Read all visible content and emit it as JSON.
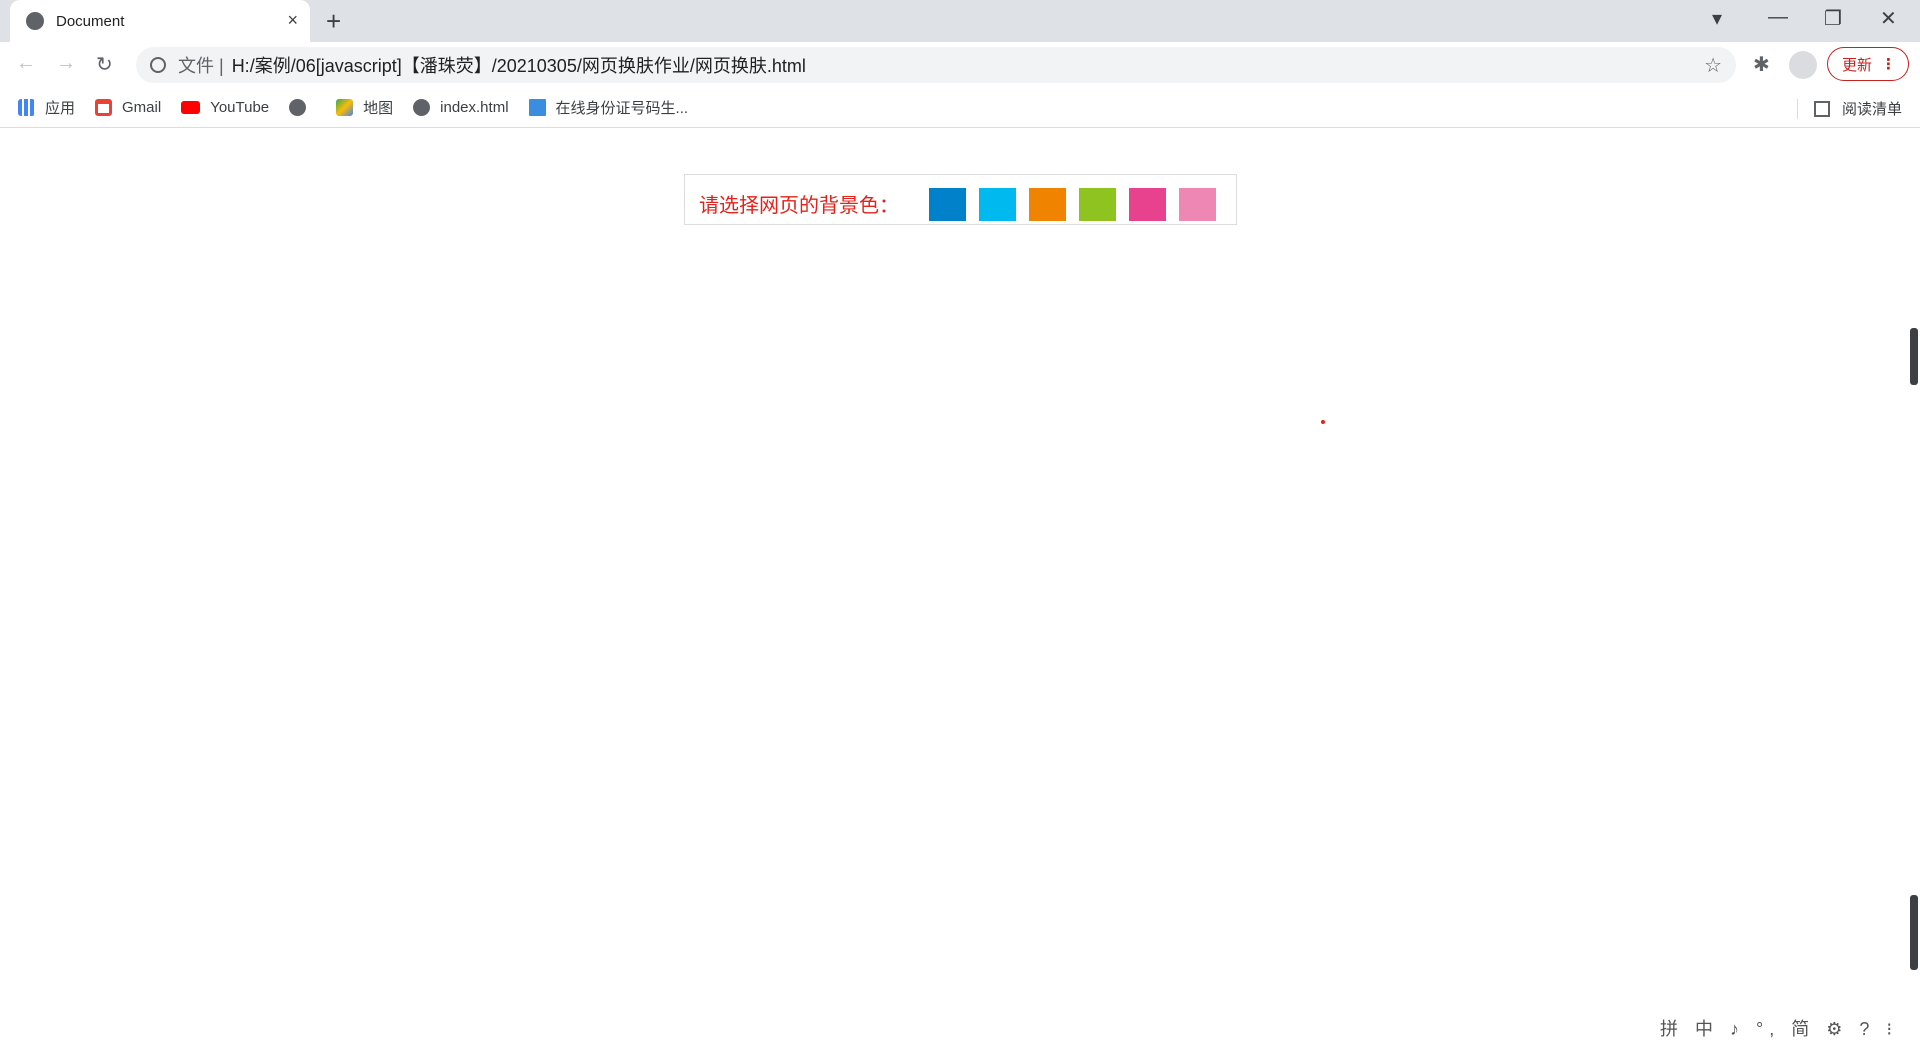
{
  "tab": {
    "title": "Document",
    "close": "×",
    "new_tab": "+"
  },
  "window": {
    "profile": "▾",
    "minimize": "—",
    "restore": "❐",
    "close": "✕"
  },
  "toolbar": {
    "back": "←",
    "forward": "→",
    "reload": "↻",
    "file_label": "文件 |",
    "url": "H:/案例/06[javascript]【潘珠荧】/20210305/网页换肤作业/网页换肤.html",
    "star": "☆",
    "extensions": "✱",
    "update_label": "更新",
    "menu": "⋮"
  },
  "bookmarks": [
    {
      "label": "应用",
      "icon": "apps-grid-icon",
      "color": "#4285f4"
    },
    {
      "label": "Gmail",
      "icon": "gmail-icon",
      "color": "#ea4335"
    },
    {
      "label": "YouTube",
      "icon": "youtube-icon",
      "color": "#ff0000"
    },
    {
      "label": "",
      "icon": "globe-icon",
      "color": "#5f6368"
    },
    {
      "label": "地图",
      "icon": "maps-icon",
      "color": "#34a853"
    },
    {
      "label": "index.html",
      "icon": "globe-icon",
      "color": "#5f6368"
    },
    {
      "label": "在线身份证号码生...",
      "icon": "cha-icon",
      "color": "#3b8de0"
    }
  ],
  "reading_list": "阅读清单",
  "page": {
    "label": "请选择网页的背景色：",
    "swatches": [
      "#0081c9",
      "#00b9ee",
      "#f08300",
      "#8fc31f",
      "#e8418d",
      "#ee87b4"
    ]
  },
  "ime": "拼 中 ♪ °, 简 ⚙ ? ⁝"
}
